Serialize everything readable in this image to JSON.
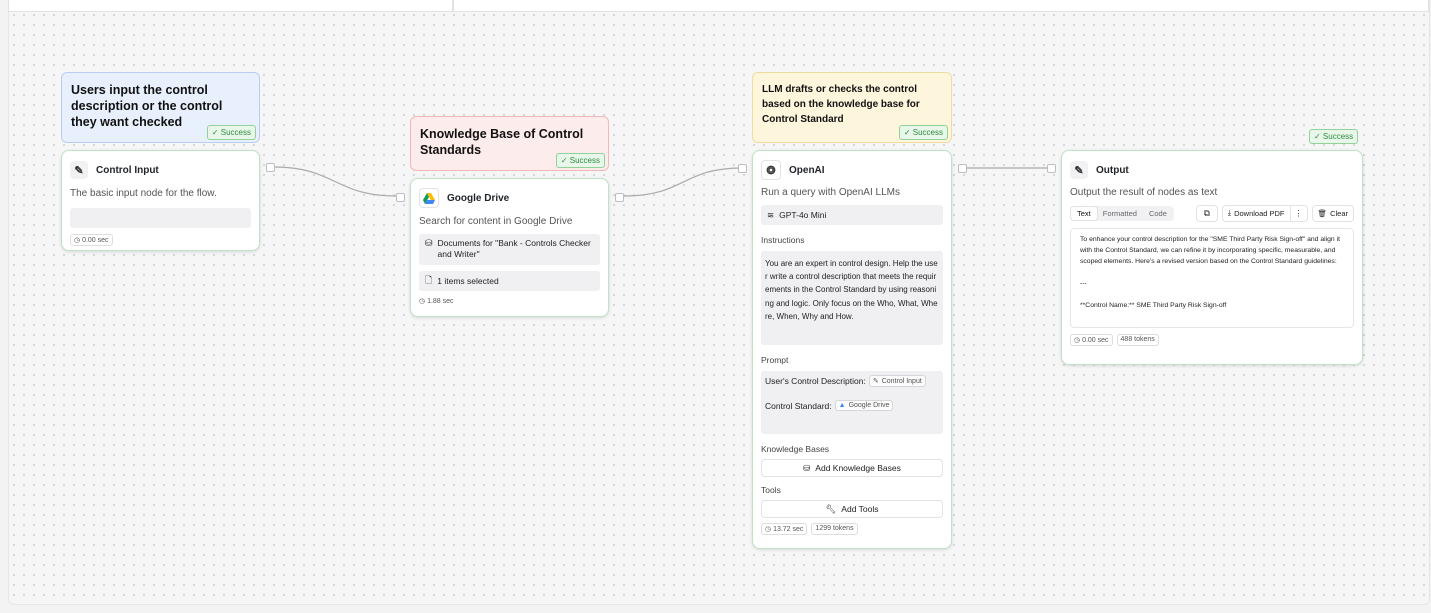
{
  "notes": {
    "input_note": "Users input the control description or the control they want checked",
    "kb_note": "Knowledge Base of Control Standards",
    "llm_note": "LLM drafts or checks the control based on the knowledge base for Control Standard"
  },
  "badge_text": "✓ Success",
  "control_input": {
    "title": "Control Input",
    "description": "The basic input node for the flow.",
    "input_value": "",
    "time": "0.00 sec"
  },
  "google_drive": {
    "title": "Google Drive",
    "description": "Search for content in Google Drive",
    "documents": "Documents for \"Bank - Controls Checker and Writer\"",
    "selection": "1 items selected",
    "time": "1.88 sec"
  },
  "openai": {
    "title": "OpenAI",
    "description": "Run a query with OpenAI LLMs",
    "model": "GPT-4o Mini",
    "instructions_label": "Instructions",
    "instructions_text": "You are an expert in control design. Help the user write a control description that meets the requirements in the Control Standard by using reasoning and logic. Only focus on the Who, What, Where, When, Why and How.",
    "prompt_label": "Prompt",
    "prompt_line1": "User's Control Description:",
    "prompt_ref1": "Control Input",
    "prompt_line2": "Control Standard:",
    "prompt_ref2": "Google Drive",
    "kb_label": "Knowledge Bases",
    "kb_button": "Add Knowledge Bases",
    "tools_label": "Tools",
    "tools_button": "Add Tools",
    "time": "13.72 sec",
    "tokens": "1299 tokens"
  },
  "output": {
    "title": "Output",
    "description": "Output the result of nodes as text",
    "tabs": [
      "Text",
      "Formatted",
      "Code"
    ],
    "download": "Download PDF",
    "more": "⋮",
    "clear": "Clear",
    "result_para": "To enhance your control description for the \"SME Third Party Risk Sign-off\" and align it with the Control Standard, we can refine it by incorporating specific, measurable, and scoped elements. Here's a revised version based on the Control Standard guidelines:",
    "result_sep": "---",
    "result_name": "**Control Name:** SME Third Party Risk Sign-off",
    "time": "0.00 sec",
    "tokens": "488 tokens"
  },
  "icons": {
    "pencil": "pencil-icon",
    "drive": "google-drive-icon",
    "openai": "openai-icon",
    "clock": "clock-icon",
    "database": "database-icon",
    "file": "file-icon",
    "layers": "layers-icon",
    "wrench": "wrench-icon",
    "copy": "copy-icon",
    "download": "download-icon",
    "trash": "trash-icon"
  },
  "colors": {
    "success_green": "#2f8a3d",
    "node_border": "#bfe3c4",
    "note_blue": "#e9f0fd",
    "note_red": "#fdecec",
    "note_yellow": "#fdf6dd"
  }
}
